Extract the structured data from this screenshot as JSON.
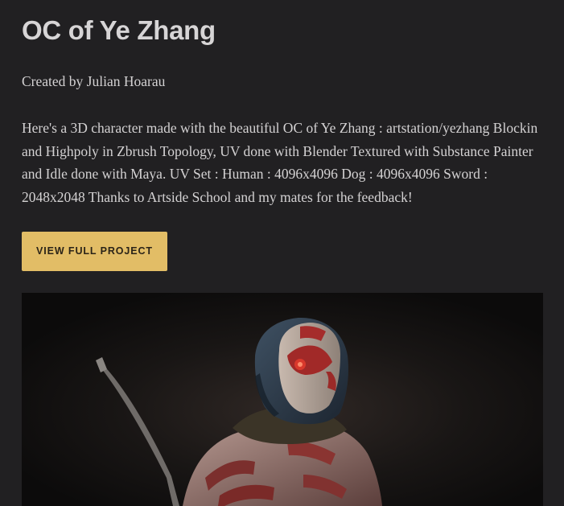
{
  "project": {
    "title": "OC of Ye Zhang",
    "byline": "Created by Julian Hoarau",
    "description": "Here's a 3D character made with the beautiful OC of Ye Zhang : artstation/yezhang Blockin and Highpoly in Zbrush Topology, UV done with Blender Textured with Substance Painter and Idle done with Maya. UV Set : Human : 4096x4096 Dog : 4096x4096 Sword : 2048x2048 Thanks to Artside School and my mates for the feedback!",
    "cta_label": "VIEW FULL PROJECT"
  },
  "colors": {
    "background": "#212022",
    "text": "#d4d2d3",
    "accent": "#e2bd66"
  }
}
